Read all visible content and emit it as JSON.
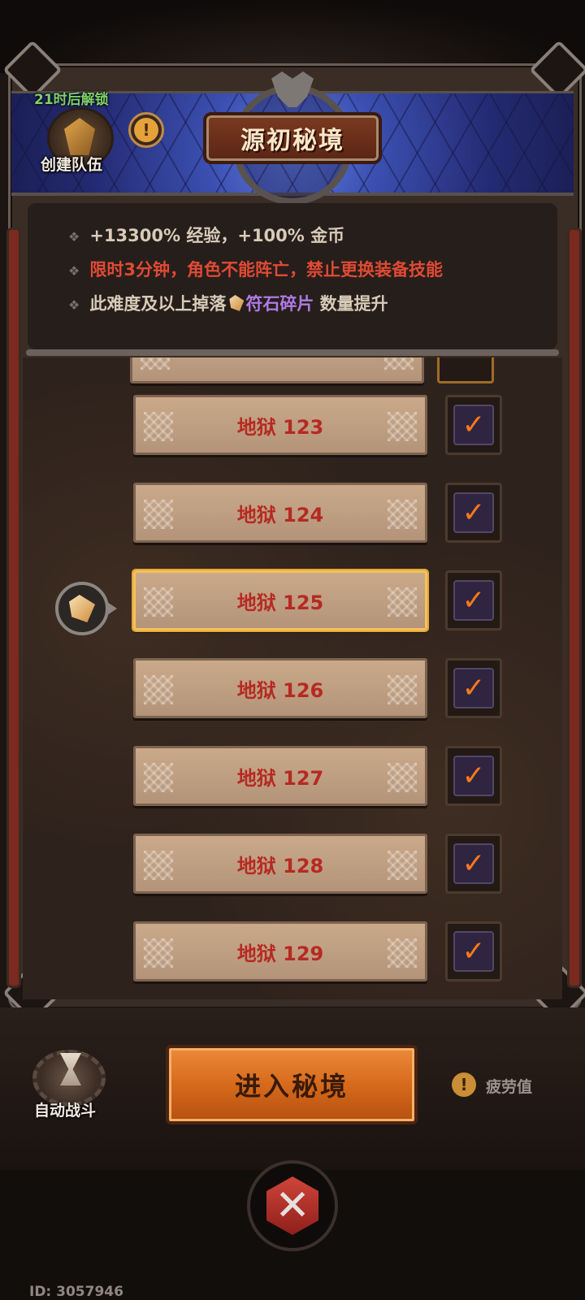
{
  "header": {
    "unlock_text": "21时后解锁",
    "team_label": "创建队伍",
    "info_mark": "!",
    "title": "源初秘境"
  },
  "info": {
    "line1": "+13300% 经验，+100% 金币",
    "line2": "限时3分钟，角色不能阵亡，禁止更换装备技能",
    "line3_pre": "此难度及以上掉落",
    "line3_item": "符石碎片",
    "line3_post": " 数量提升"
  },
  "levels": [
    {
      "label": "地狱 123",
      "checked": true
    },
    {
      "label": "地狱 124",
      "checked": true
    },
    {
      "label": "地狱 125",
      "checked": true,
      "selected": true
    },
    {
      "label": "地狱 126",
      "checked": true
    },
    {
      "label": "地狱 127",
      "checked": true
    },
    {
      "label": "地狱 128",
      "checked": true
    },
    {
      "label": "地狱 129",
      "checked": true
    }
  ],
  "controls": {
    "auto_battle": "自动战斗",
    "enter": "进入秘境",
    "fatigue_mark": "!",
    "fatigue": "疲劳值",
    "close": "✕"
  },
  "footer": {
    "user_id": "ID: 3057946"
  },
  "colors": {
    "accent_orange": "#d66a1c",
    "level_text_red": "#b52a22",
    "warning_red": "#e04a35",
    "highlight_purple": "#b07ae6",
    "unlock_green": "#7fd06a"
  }
}
